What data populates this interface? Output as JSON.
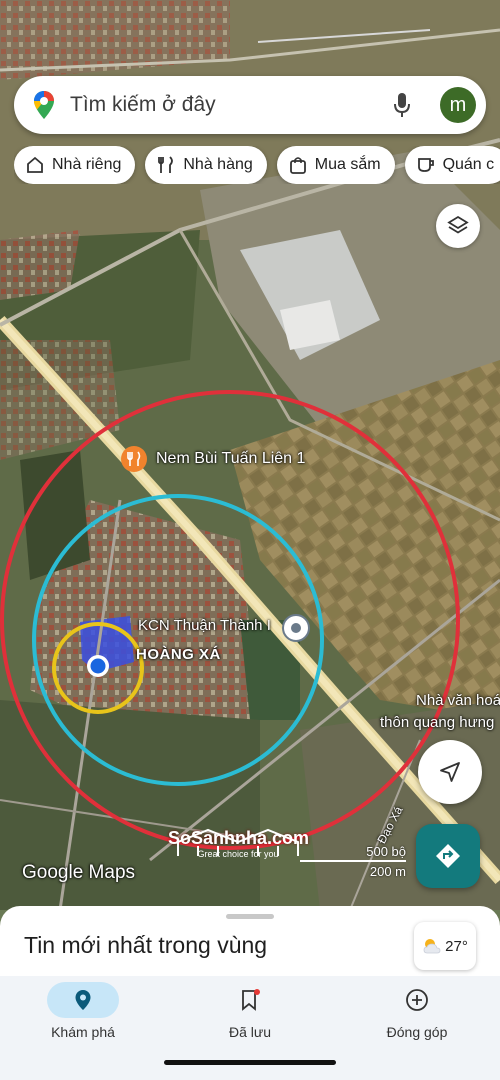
{
  "search": {
    "placeholder": "Tìm kiếm ở đây",
    "avatar_letter": "m"
  },
  "chips": [
    {
      "label": "Nhà riêng",
      "icon": "home-icon"
    },
    {
      "label": "Nhà hàng",
      "icon": "restaurant-icon"
    },
    {
      "label": "Mua sắm",
      "icon": "shopping-bag-icon"
    },
    {
      "label": "Quán c",
      "icon": "coffee-icon"
    }
  ],
  "map": {
    "poi_name": "Nem Bùi Tuấn Liên 1",
    "kcn_label": "KCN Thuận Thành I",
    "area_label": "HOÀNG XÁ",
    "community_line1": "Nhà văn hoá",
    "community_line2": "thôn quang hưng",
    "road_label": "Đạo Xá",
    "scale_ft": "500 bộ",
    "scale_m": "200 m",
    "attribution": "Google Maps",
    "watermark_brand": "SoSanhnha.com",
    "watermark_tag": "Great choice for you",
    "circle_colors": {
      "red": "#e0303a",
      "cyan": "#2bbcd4",
      "yellow": "#e8c41a"
    }
  },
  "sheet": {
    "title": "Tin mới nhất trong vùng"
  },
  "weather": {
    "temp": "27°"
  },
  "nav": [
    {
      "label": "Khám phá",
      "icon": "explore-pin-icon",
      "active": true
    },
    {
      "label": "Đã lưu",
      "icon": "bookmark-icon",
      "active": false
    },
    {
      "label": "Đóng góp",
      "icon": "add-circle-icon",
      "active": false
    }
  ]
}
